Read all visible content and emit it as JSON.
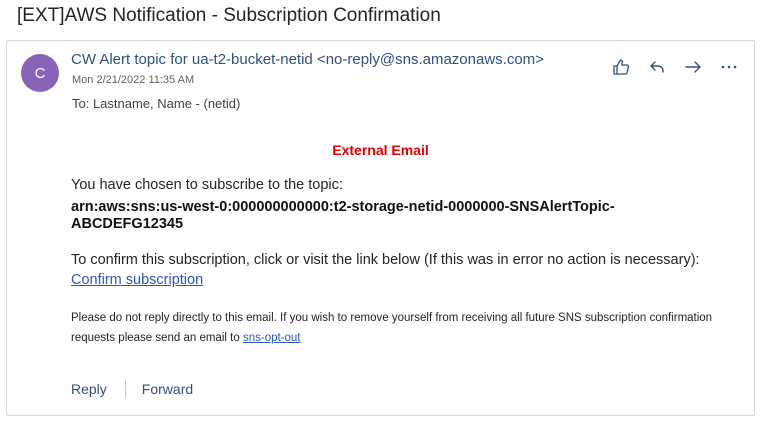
{
  "subject": "[EXT]AWS Notification - Subscription Confirmation",
  "sender": {
    "avatar_letter": "C",
    "name": "CW Alert topic for ua-t2-bucket-netid",
    "address": "<no-reply@sns.amazonaws.com>",
    "date": "Mon 2/21/2022 11:35 AM",
    "to": "To:  Lastname, Name - (netid)"
  },
  "actions": [
    {
      "icon": "like-icon"
    },
    {
      "icon": "reply-icon"
    },
    {
      "icon": "forward-icon"
    },
    {
      "icon": "more-icon"
    }
  ],
  "body": {
    "external_banner": "External Email",
    "intro": "You have chosen to subscribe to the topic:",
    "arn": "arn:aws:sns:us-west-0:000000000000:t2-storage-netid-0000000-SNSAlertTopic-ABCDEFG12345",
    "confirm_text": "To confirm this subscription, click or visit the link below (If this was in error no action is necessary):",
    "confirm_link": "Confirm subscription",
    "footnote": "Please do not reply directly to this email. If you wish to remove yourself from receiving all future SNS subscription confirmation requests please send an email to ",
    "footnote_link": "sns-opt-out"
  },
  "reply_bar": {
    "reply": "Reply",
    "forward": "Forward"
  },
  "colors": {
    "avatar": "#8764b8",
    "link": "#2a55c7",
    "accent": "#2f4f86",
    "external": "#e00000"
  }
}
